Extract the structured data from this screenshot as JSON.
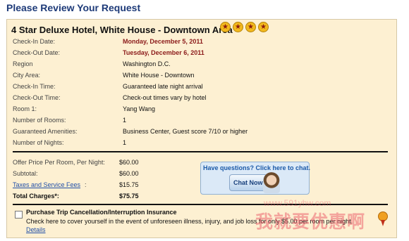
{
  "page": {
    "title": "Please Review Your Request"
  },
  "hotel": {
    "name": "4 Star Deluxe Hotel, White House - Downtown Area",
    "star_count": 4
  },
  "details": [
    {
      "label": "Check-In Date:",
      "value": "Monday, December 5, 2011",
      "highlight": true
    },
    {
      "label": "Check-Out Date:",
      "value": "Tuesday, December 6, 2011",
      "highlight": true
    },
    {
      "label": "Region",
      "value": "Washington D.C."
    },
    {
      "label": "City Area:",
      "value": "White House - Downtown"
    },
    {
      "label": "Check-In Time:",
      "value": "Guaranteed late night arrival"
    },
    {
      "label": "Check-Out Time:",
      "value": "Check-out times vary by hotel"
    },
    {
      "label": "Room 1:",
      "value": "Yang Wang"
    },
    {
      "label": "Number of Rooms:",
      "value": "1"
    },
    {
      "label": "Guaranteed Amenities:",
      "value": "Business Center, Guest score 7/10 or higher"
    },
    {
      "label": "Number of Nights:",
      "value": "1"
    }
  ],
  "charges": [
    {
      "label": "Offer Price Per Room, Per Night:",
      "value": "$60.00"
    },
    {
      "label": "Subtotal:",
      "value": "$60.00"
    },
    {
      "label": "Taxes and Service Fees",
      "value": "$15.75",
      "link": true
    },
    {
      "label": "Total Charges*:",
      "value": "$75.75",
      "bold": true
    }
  ],
  "chat": {
    "question": "Have questions?  Click here to chat.",
    "button_label": "Chat Now"
  },
  "insurance": {
    "title": "Purchase Trip Cancellation/Interruption Insurance",
    "description": "Check here to cover yourself in the event of unforeseen illness, injury, and job loss for only $5.00 per room per night.",
    "details_link": "Details",
    "checked": false
  },
  "watermark": {
    "text": "我就要优惠啊",
    "url": "www.591yhw.com"
  },
  "colors": {
    "title": "#1d3a78",
    "panel_bg": "#fdf0d2",
    "date_red": "#8b1a1a",
    "link_blue": "#1f4fa8"
  }
}
